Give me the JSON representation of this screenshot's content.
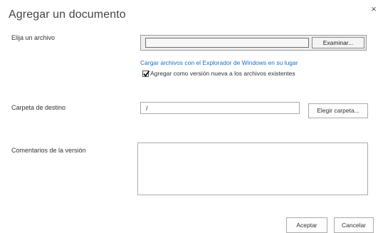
{
  "dialog": {
    "title": "Agregar un documento",
    "close_glyph": "×",
    "close_icon": "close-icon"
  },
  "file_section": {
    "label": "Elija un archivo",
    "browse_label": "Examinar...",
    "explorer_link": "Cargar archivos con el Explorador de Windows en su lugar",
    "checkbox_label": "Agregar como versión nueva a los archivos existentes",
    "checkbox_checked": true
  },
  "folder_section": {
    "label": "Carpeta de destino",
    "value": "/",
    "choose_label": "Elegir carpeta..."
  },
  "comments_section": {
    "label": "Comentarios de la versión",
    "value": ""
  },
  "footer": {
    "accept_label": "Aceptar",
    "cancel_label": "Cancelar"
  },
  "colors": {
    "link": "#1a6fc0",
    "border": "#ababab",
    "text": "#333333"
  }
}
